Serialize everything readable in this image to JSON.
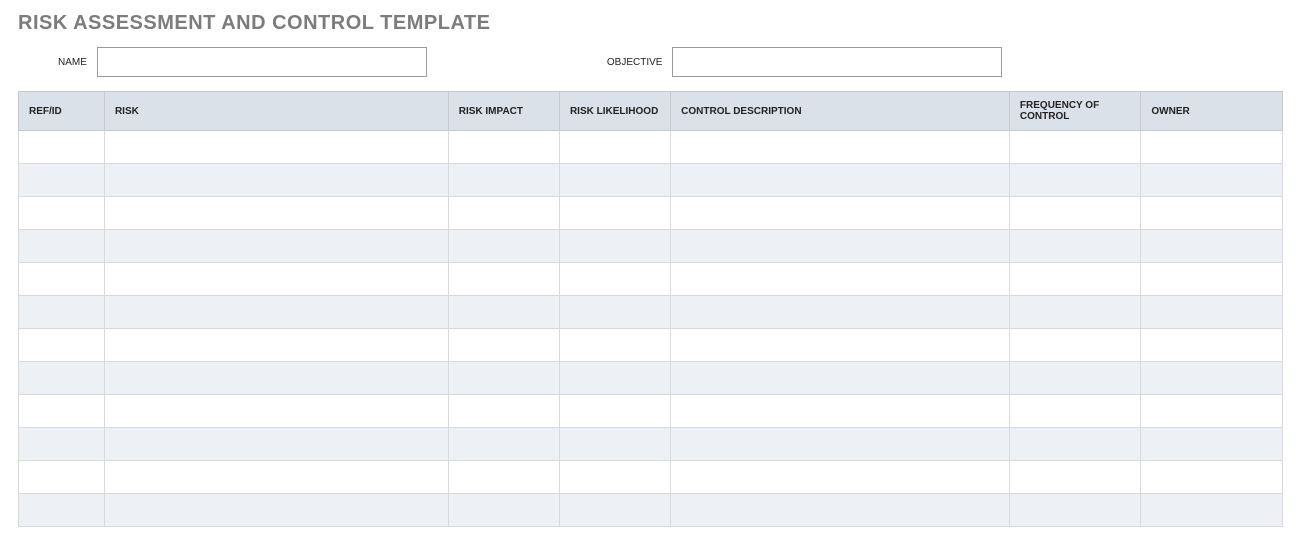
{
  "title": "RISK ASSESSMENT AND CONTROL TEMPLATE",
  "meta": {
    "name_label": "NAME",
    "name_value": "",
    "objective_label": "OBJECTIVE",
    "objective_value": ""
  },
  "columns": {
    "ref": "REF/ID",
    "risk": "RISK",
    "impact": "RISK IMPACT",
    "likelihood": "RISK LIKELIHOOD",
    "control": "CONTROL DESCRIPTION",
    "frequency": "FREQUENCY OF CONTROL",
    "owner": "OWNER"
  },
  "rows": [
    {
      "ref": "",
      "risk": "",
      "impact": "",
      "likelihood": "",
      "control": "",
      "frequency": "",
      "owner": ""
    },
    {
      "ref": "",
      "risk": "",
      "impact": "",
      "likelihood": "",
      "control": "",
      "frequency": "",
      "owner": ""
    },
    {
      "ref": "",
      "risk": "",
      "impact": "",
      "likelihood": "",
      "control": "",
      "frequency": "",
      "owner": ""
    },
    {
      "ref": "",
      "risk": "",
      "impact": "",
      "likelihood": "",
      "control": "",
      "frequency": "",
      "owner": ""
    },
    {
      "ref": "",
      "risk": "",
      "impact": "",
      "likelihood": "",
      "control": "",
      "frequency": "",
      "owner": ""
    },
    {
      "ref": "",
      "risk": "",
      "impact": "",
      "likelihood": "",
      "control": "",
      "frequency": "",
      "owner": ""
    },
    {
      "ref": "",
      "risk": "",
      "impact": "",
      "likelihood": "",
      "control": "",
      "frequency": "",
      "owner": ""
    },
    {
      "ref": "",
      "risk": "",
      "impact": "",
      "likelihood": "",
      "control": "",
      "frequency": "",
      "owner": ""
    },
    {
      "ref": "",
      "risk": "",
      "impact": "",
      "likelihood": "",
      "control": "",
      "frequency": "",
      "owner": ""
    },
    {
      "ref": "",
      "risk": "",
      "impact": "",
      "likelihood": "",
      "control": "",
      "frequency": "",
      "owner": ""
    },
    {
      "ref": "",
      "risk": "",
      "impact": "",
      "likelihood": "",
      "control": "",
      "frequency": "",
      "owner": ""
    },
    {
      "ref": "",
      "risk": "",
      "impact": "",
      "likelihood": "",
      "control": "",
      "frequency": "",
      "owner": ""
    }
  ]
}
